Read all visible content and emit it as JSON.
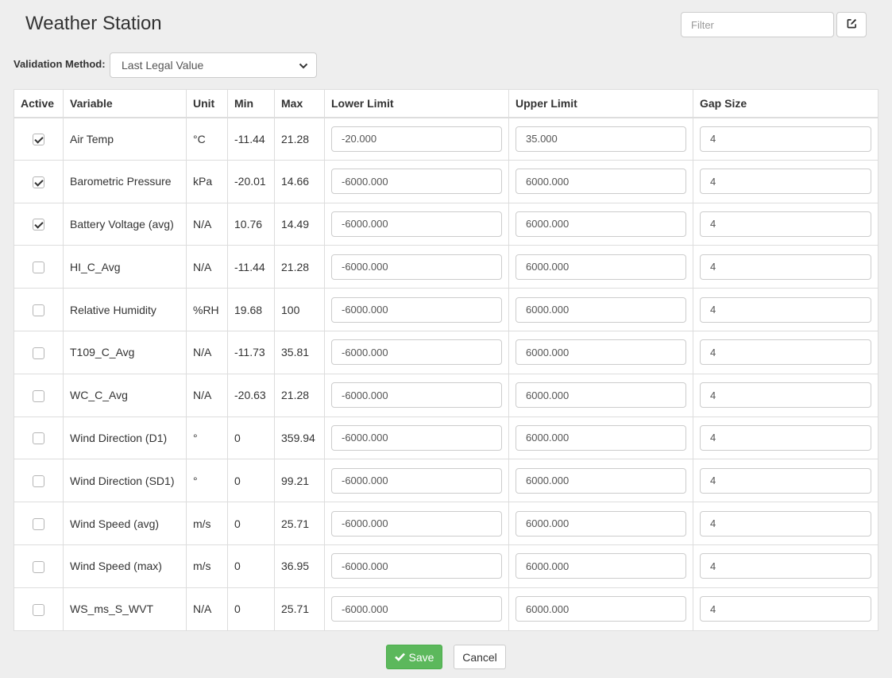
{
  "header": {
    "title": "Weather Station",
    "filter_placeholder": "Filter",
    "edit_icon": "edit-icon"
  },
  "validation": {
    "label": "Validation Method:",
    "selected": "Last Legal Value",
    "icon": "chevron-down-icon"
  },
  "table": {
    "columns": [
      "Active",
      "Variable",
      "Unit",
      "Min",
      "Max",
      "Lower Limit",
      "Upper Limit",
      "Gap Size"
    ],
    "rows": [
      {
        "active": true,
        "variable": "Air Temp",
        "unit": "°C",
        "min": "-11.44",
        "max": "21.28",
        "lower": "-20.000",
        "upper": "35.000",
        "gap": "4"
      },
      {
        "active": true,
        "variable": "Barometric Pressure",
        "unit": "kPa",
        "min": "-20.01",
        "max": "14.66",
        "lower": "-6000.000",
        "upper": "6000.000",
        "gap": "4"
      },
      {
        "active": true,
        "variable": "Battery Voltage (avg)",
        "unit": "N/A",
        "min": "10.76",
        "max": "14.49",
        "lower": "-6000.000",
        "upper": "6000.000",
        "gap": "4"
      },
      {
        "active": false,
        "variable": "HI_C_Avg",
        "unit": "N/A",
        "min": "-11.44",
        "max": "21.28",
        "lower": "-6000.000",
        "upper": "6000.000",
        "gap": "4"
      },
      {
        "active": false,
        "variable": "Relative Humidity",
        "unit": "%RH",
        "min": "19.68",
        "max": "100",
        "lower": "-6000.000",
        "upper": "6000.000",
        "gap": "4"
      },
      {
        "active": false,
        "variable": "T109_C_Avg",
        "unit": "N/A",
        "min": "-11.73",
        "max": "35.81",
        "lower": "-6000.000",
        "upper": "6000.000",
        "gap": "4"
      },
      {
        "active": false,
        "variable": "WC_C_Avg",
        "unit": "N/A",
        "min": "-20.63",
        "max": "21.28",
        "lower": "-6000.000",
        "upper": "6000.000",
        "gap": "4"
      },
      {
        "active": false,
        "variable": "Wind Direction (D1)",
        "unit": "°",
        "min": "0",
        "max": "359.94",
        "lower": "-6000.000",
        "upper": "6000.000",
        "gap": "4"
      },
      {
        "active": false,
        "variable": "Wind Direction (SD1)",
        "unit": "°",
        "min": "0",
        "max": "99.21",
        "lower": "-6000.000",
        "upper": "6000.000",
        "gap": "4"
      },
      {
        "active": false,
        "variable": "Wind Speed (avg)",
        "unit": "m/s",
        "min": "0",
        "max": "25.71",
        "lower": "-6000.000",
        "upper": "6000.000",
        "gap": "4"
      },
      {
        "active": false,
        "variable": "Wind Speed (max)",
        "unit": "m/s",
        "min": "0",
        "max": "36.95",
        "lower": "-6000.000",
        "upper": "6000.000",
        "gap": "4"
      },
      {
        "active": false,
        "variable": "WS_ms_S_WVT",
        "unit": "N/A",
        "min": "0",
        "max": "25.71",
        "lower": "-6000.000",
        "upper": "6000.000",
        "gap": "4"
      }
    ]
  },
  "actions": {
    "save_label": "Save",
    "save_icon": "check-icon",
    "cancel_label": "Cancel"
  },
  "colors": {
    "background": "#eeeeee",
    "save_button": "#5cb85c",
    "border": "#dddddd"
  }
}
